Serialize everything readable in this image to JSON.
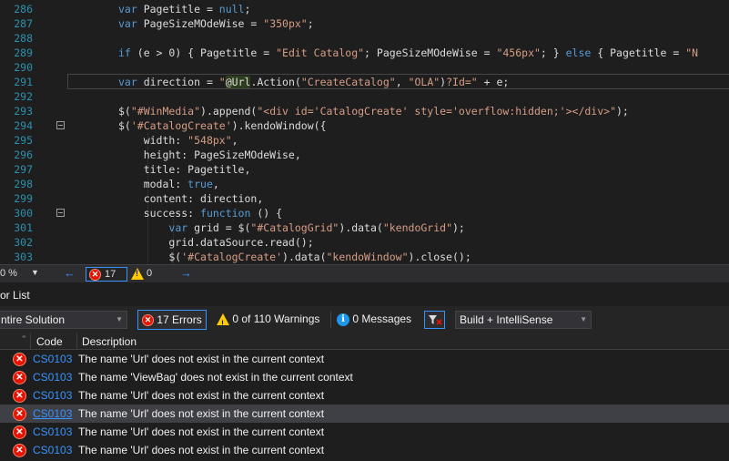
{
  "editor": {
    "lines": [
      {
        "num": "286",
        "text": "    var Pagetitle = null;"
      },
      {
        "num": "287",
        "text": "    var PageSizeMOdeWise = \"350px\";"
      },
      {
        "num": "288",
        "text": ""
      },
      {
        "num": "289",
        "text": "    if (e > 0) { Pagetitle = \"Edit Catalog\"; PageSizeMOdeWise = \"456px\"; } else { Pagetitle = \"N"
      },
      {
        "num": "290",
        "text": ""
      },
      {
        "num": "291",
        "text": "    var direction = \"@Url.Action(\"CreateCatalog\", \"OLA\")?Id=\" + e;"
      },
      {
        "num": "292",
        "text": ""
      },
      {
        "num": "293",
        "text": "    $(\"#WinMedia\").append(\"<div id='CatalogCreate' style='overflow:hidden;'></div>\");"
      },
      {
        "num": "294",
        "text": "    $('#CatalogCreate').kendoWindow({"
      },
      {
        "num": "295",
        "text": "        width: \"548px\","
      },
      {
        "num": "296",
        "text": "        height: PageSizeMOdeWise,"
      },
      {
        "num": "297",
        "text": "        title: Pagetitle,"
      },
      {
        "num": "298",
        "text": "        modal: true,"
      },
      {
        "num": "299",
        "text": "        content: direction,"
      },
      {
        "num": "300",
        "text": "        success: function () {"
      },
      {
        "num": "301",
        "text": "            var grid = $(\"#CatalogGrid\").data(\"kendoGrid\");"
      },
      {
        "num": "302",
        "text": "            grid.dataSource.read();"
      },
      {
        "num": "303",
        "text": "            $('#CatalogCreate').data(\"kendoWindow\").close();"
      }
    ]
  },
  "status_strip": {
    "zoom": "0 %",
    "error_count": "17",
    "warning_count": "0"
  },
  "error_list": {
    "title": "or List",
    "scope": "ntire Solution",
    "errors_label": "17 Errors",
    "warnings_label": "0 of 110 Warnings",
    "messages_label": "0 Messages",
    "source": "Build + IntelliSense",
    "columns": {
      "code": "Code",
      "description": "Description"
    },
    "rows": [
      {
        "code": "CS0103",
        "description": "The name 'Url' does not exist in the current context"
      },
      {
        "code": "CS0103",
        "description": "The name 'ViewBag' does not exist in the current context"
      },
      {
        "code": "CS0103",
        "description": "The name 'Url' does not exist in the current context"
      },
      {
        "code": "CS0103",
        "description": "The name 'Url' does not exist in the current context"
      },
      {
        "code": "CS0103",
        "description": "The name 'Url' does not exist in the current context"
      },
      {
        "code": "CS0103",
        "description": "The name 'Url' does not exist in the current context"
      }
    ]
  },
  "colors": {
    "background": "#1e1e1e",
    "line_number": "#2b91af",
    "keyword": "#569cd6",
    "string": "#d69d85",
    "link": "#3794ff",
    "error": "#e51400",
    "warning": "#ffcc00"
  },
  "icons": [
    "fold-collapse-icon",
    "error-icon",
    "warning-icon",
    "info-icon",
    "filter-icon"
  ]
}
